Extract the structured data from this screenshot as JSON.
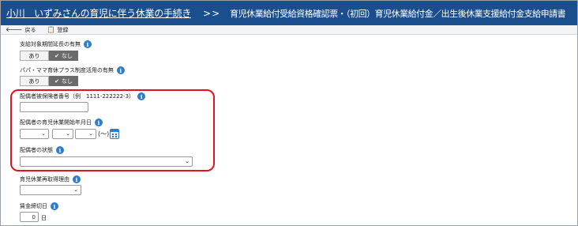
{
  "header": {
    "person_link": "小川　いずみさんの育児に伴う休業の手続き",
    "separator": ">>",
    "form_title": "育児休業給付受給資格確認票・（初回）育児休業給付金／出生後休業支援給付金支給申請書"
  },
  "toolbar": {
    "back_label": "戻る",
    "register_label": "登録"
  },
  "fields": {
    "payment_extension": {
      "label": "支給対象期間延長の有無",
      "option_yes": "あり",
      "option_no": "なし",
      "selected": "なし"
    },
    "papa_mama_plus": {
      "label": "パパ・ママ育休プラス制度活用の有無",
      "option_yes": "あり",
      "option_no": "なし",
      "selected": "なし"
    },
    "spouse_insured_number": {
      "label": "配偶者被保険者番号（例　1111-222222-3）",
      "value": ""
    },
    "spouse_leave_start": {
      "label": "配偶者の育児休業開始年月日",
      "year": "",
      "month": "",
      "day": "",
      "paren_text": "(～)"
    },
    "spouse_status": {
      "label": "配偶者の状態",
      "value": ""
    },
    "reacquire_reason": {
      "label": "育児休業再取得理由",
      "value": ""
    },
    "wage_cutoff_day": {
      "label": "賃金締切日",
      "value": "0",
      "unit": "日"
    }
  },
  "colors": {
    "header_bg": "#1a4e8c",
    "highlight": "#e0141e",
    "info_icon": "#2f7dc9",
    "toggle_selected": "#6b6b6b"
  }
}
